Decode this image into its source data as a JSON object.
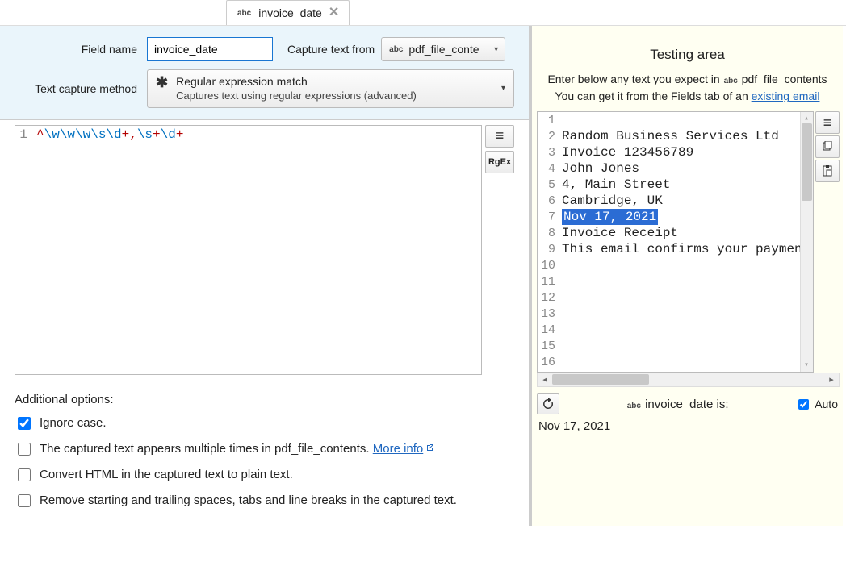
{
  "tab": {
    "label": "invoice_date"
  },
  "config": {
    "field_name_label": "Field name",
    "field_name_value": "invoice_date",
    "capture_from_label": "Capture text from",
    "capture_from_value": "pdf_file_conte",
    "method_label": "Text capture method",
    "method_title": "Regular expression match",
    "method_sub": "Captures text using regular expressions (advanced)"
  },
  "regex": {
    "line_no": "1",
    "parts": {
      "p1": "^",
      "p2": "\\w\\w\\w\\s\\d",
      "p3": "+,",
      "p4": "\\s",
      "p5": "+",
      "p6": "\\d",
      "p7": "+"
    }
  },
  "sidebuttons": {
    "menu": "≡",
    "rgex": "RgEx"
  },
  "options": {
    "heading": "Additional options:",
    "opt1": "Ignore case.",
    "opt2_a": "The captured text appears multiple times in pdf_file_contents. ",
    "opt2_link": "More info",
    "opt3": "Convert HTML in the captured text to plain text.",
    "opt4": "Remove starting and trailing spaces, tabs and line breaks in the captured text."
  },
  "testing": {
    "heading": "Testing area",
    "hint1a": "Enter below any text you expect in ",
    "hint1b": " pdf_file_contents",
    "hint2a": "You can get it from the Fields tab of an ",
    "hint2link": "existing email",
    "lines": {
      "l1": "Random Business Services Ltd",
      "l2": "",
      "l3": "Invoice 123456789",
      "l4": "",
      "l5": "John Jones",
      "l6": "",
      "l7": "4, Main Street",
      "l8": "",
      "l9": "Cambridge, UK",
      "l10": "",
      "l11": "Nov 17, 2021",
      "l12": "",
      "l13": "",
      "l14": "Invoice Receipt",
      "l15": "",
      "l16": "This email confirms your payment "
    },
    "nums": {
      "n1": "1",
      "n2": "2",
      "n3": "3",
      "n4": "4",
      "n5": "5",
      "n6": "6",
      "n7": "7",
      "n8": "8",
      "n9": "9",
      "n10": "10",
      "n11": "11",
      "n12": "12",
      "n13": "13",
      "n14": "14",
      "n15": "15",
      "n16": "16"
    },
    "result_label_a": "invoice_date is:",
    "auto_label": "Auto",
    "result_value": "Nov 17, 2021"
  },
  "rightstrip": {
    "menu": "≡",
    "copy": "⧉",
    "paste": "📋"
  }
}
